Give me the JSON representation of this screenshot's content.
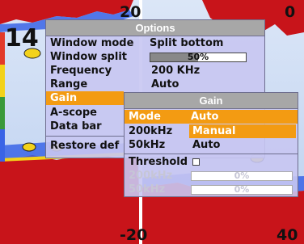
{
  "depth_scale": {
    "top_left": "20",
    "top_right": "0",
    "bottom_left": "-20",
    "bottom_right": "40"
  },
  "depth_readout": "14",
  "options_menu": {
    "title": "Options",
    "items": [
      {
        "label": "Window mode",
        "value": "Split bottom"
      },
      {
        "label": "Window split",
        "value": "50%",
        "level_percent": 50
      },
      {
        "label": "Frequency",
        "value": "200 KHz"
      },
      {
        "label": "Range",
        "value": "Auto"
      },
      {
        "label": "Gain",
        "value": "",
        "selected": true
      },
      {
        "label": "A-scope",
        "value": ""
      },
      {
        "label": "Data bar",
        "value": ""
      },
      {
        "label": "Restore def",
        "value": ""
      }
    ]
  },
  "gain_menu": {
    "title": "Gain",
    "mode": {
      "label": "Mode",
      "value": "Auto"
    },
    "khz200": {
      "label": "200kHz",
      "value": "Manual"
    },
    "khz50": {
      "label": "50kHz",
      "value": "Auto"
    },
    "threshold": {
      "label": "Threshold",
      "checked": false
    },
    "th200": {
      "label": "200kHz",
      "value": "0%",
      "level_percent": 0
    },
    "th50": {
      "label": "50kHz",
      "value": "0%",
      "level_percent": 0
    }
  },
  "colors": {
    "menu_bg": "#c8c6f2",
    "title_bar": "#a7a7a7",
    "highlight": "#f39b12",
    "sonar_red": "#c8141a",
    "sonar_blue": "#3a64e6"
  }
}
